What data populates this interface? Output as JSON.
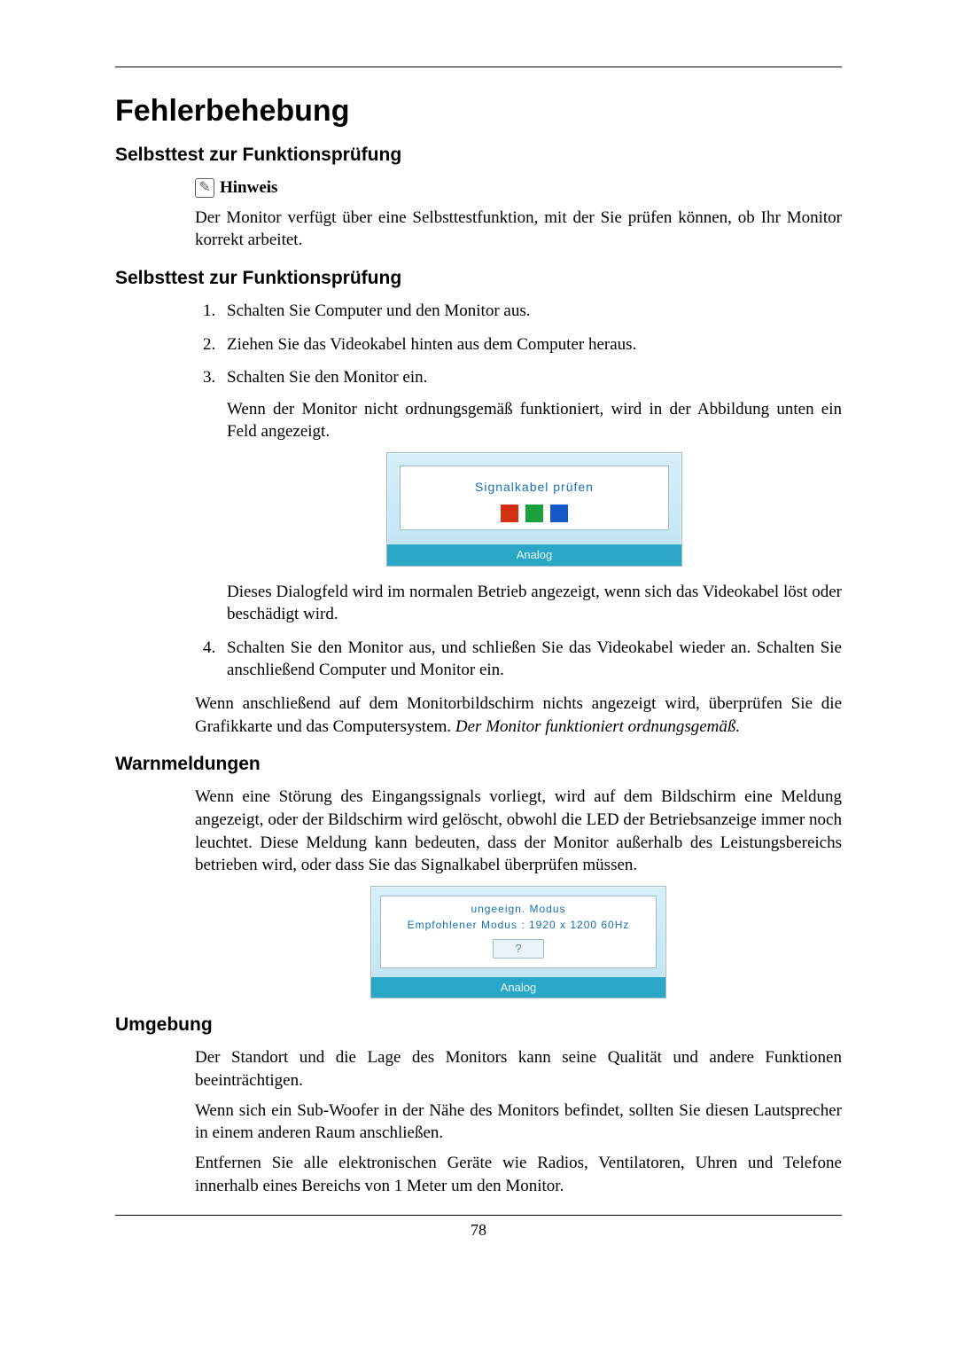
{
  "page_number": "78",
  "title": "Fehlerbehebung",
  "sections": {
    "selftest1": {
      "heading": "Selbsttest zur Funktionsprüfung",
      "note_label": "Hinweis",
      "note_text": "Der Monitor verfügt über eine Selbsttestfunktion, mit der Sie prüfen können, ob Ihr Monitor korrekt arbeitet."
    },
    "selftest2": {
      "heading": "Selbsttest zur Funktionsprüfung",
      "steps": [
        "Schalten Sie Computer und den Monitor aus.",
        "Ziehen Sie das Videokabel hinten aus dem Computer heraus.",
        "Schalten Sie den Monitor ein."
      ],
      "step3_followup": "Wenn der Monitor nicht ordnungsgemäß funktioniert, wird in der Abbildung unten ein Feld angezeigt.",
      "dialog1": {
        "message": "Signalkabel prüfen",
        "footer": "Analog"
      },
      "step3_after_dialog": "Dieses Dialogfeld wird im normalen Betrieb angezeigt, wenn sich das Videokabel löst oder beschädigt wird.",
      "step4": "Schalten Sie den Monitor aus, und schließen Sie das Videokabel wieder an. Schalten Sie anschließend Computer und Monitor ein.",
      "conclusion_plain": "Wenn anschließend auf dem Monitorbildschirm nichts angezeigt wird, überprüfen Sie die Grafikkarte und das Computersystem. ",
      "conclusion_italic": "Der Monitor funktioniert ordnungsgemäß."
    },
    "warnings": {
      "heading": "Warnmeldungen",
      "text": "Wenn eine Störung des Eingangssignals vorliegt, wird auf dem Bildschirm eine Meldung angezeigt, oder der Bildschirm wird gelöscht, obwohl die LED der Betriebsanzeige immer noch leuchtet. Diese Meldung kann bedeuten, dass der Monitor außerhalb des Leistungsbereichs betrieben wird, oder dass Sie das Signalkabel überprüfen müssen.",
      "dialog2": {
        "line1": "ungeeign. Modus",
        "line2": "Empfohlener Modus : 1920 x 1200  60Hz",
        "button": "?",
        "footer": "Analog"
      }
    },
    "environment": {
      "heading": "Umgebung",
      "p1": "Der Standort und die Lage des Monitors kann seine Qualität und andere Funktionen beeinträchtigen.",
      "p2": "Wenn sich ein Sub-Woofer in der Nähe des Monitors befindet, sollten Sie diesen Lautsprecher in einem anderen Raum anschließen.",
      "p3": "Entfernen Sie alle elektronischen Geräte wie Radios, Ventilatoren, Uhren und Telefone innerhalb eines Bereichs von 1 Meter um den Monitor."
    }
  }
}
